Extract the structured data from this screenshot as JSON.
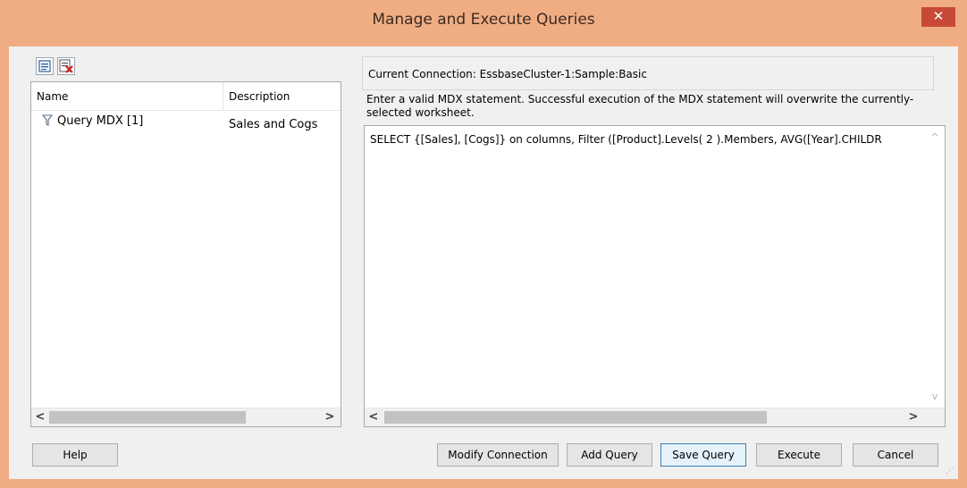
{
  "window": {
    "title": "Manage and Execute Queries",
    "close_glyph": "✕"
  },
  "toolbar": {
    "icons": [
      "query-list-icon",
      "delete-query-icon"
    ]
  },
  "query_list": {
    "columns": [
      "Name",
      "Description"
    ],
    "rows": [
      {
        "name": "Query MDX [1]",
        "description": "Sales and Cogs"
      }
    ]
  },
  "connection": {
    "label": "Current Connection: EssbaseCluster-1:Sample:Basic"
  },
  "instructions": "Enter a valid MDX statement. Successful execution of the MDX statement will overwrite the currently-selected worksheet.",
  "query_text": "SELECT {[Sales], [Cogs]} on columns, Filter ([Product].Levels( 2 ).Members, AVG([Year].CHILDR",
  "scroll_glyphs": {
    "left": "<",
    "right": ">",
    "up": "^",
    "down": "v"
  },
  "buttons": {
    "help": "Help",
    "modify_connection": "Modify Connection",
    "add_query": "Add Query",
    "save_query": "Save Query",
    "execute": "Execute",
    "cancel": "Cancel"
  },
  "colors": {
    "title_bar": "#f0ad83",
    "close_button": "#c74a39",
    "dialog_bg": "#f0f0f0"
  }
}
